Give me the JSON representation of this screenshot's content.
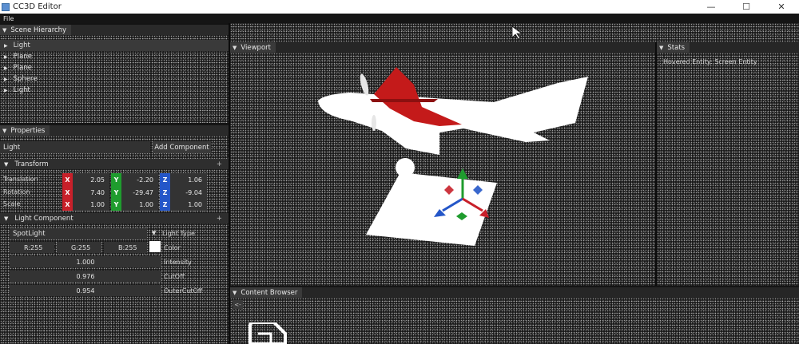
{
  "window": {
    "title": "CC3D Editor",
    "controls": [
      "—",
      "☐",
      "✕"
    ]
  },
  "menu": {
    "items": [
      "File"
    ]
  },
  "hierarchy": {
    "tab_label": "Scene Hierarchy",
    "items": [
      "Light",
      "Plane",
      "Plane",
      "Sphere",
      "Light"
    ]
  },
  "properties": {
    "tab_label": "Properties",
    "entity_name": "Light",
    "add_component_label": "Add Component",
    "transform": {
      "header": "Transform",
      "rows": [
        {
          "label": "Translation",
          "x": "2.05",
          "y": "-2.20",
          "z": "1.06"
        },
        {
          "label": "Rotation",
          "x": "7.40",
          "y": "-29.47",
          "z": "-9.04"
        },
        {
          "label": "Scale",
          "x": "1.00",
          "y": "1.00",
          "z": "1.00"
        }
      ]
    },
    "light_component": {
      "header": "Light Component",
      "light_type_value": "SpotLight",
      "light_type_label": "Light Type",
      "r": "R:255",
      "g": "G:255",
      "b": "B:255",
      "color_label": "Color",
      "intensity_value": "1.000",
      "intensity_label": "Intensity",
      "cutoff_value": "0.976",
      "cutoff_label": "CutOff",
      "outer_cutoff_value": "0.954",
      "outer_cutoff_label": "OuterCutOff"
    }
  },
  "viewport": {
    "tab_label": "Viewport"
  },
  "stats": {
    "tab_label": "Stats",
    "hovered_text": "Hovered Entity: Screen Entity"
  },
  "content_browser": {
    "tab_label": "Content Browser",
    "back_label": "<-"
  },
  "colors": {
    "axis_x": "#c8202a",
    "axis_y": "#1f9c2e",
    "axis_z": "#2456c8",
    "plane_tail": "#c41a1a"
  }
}
